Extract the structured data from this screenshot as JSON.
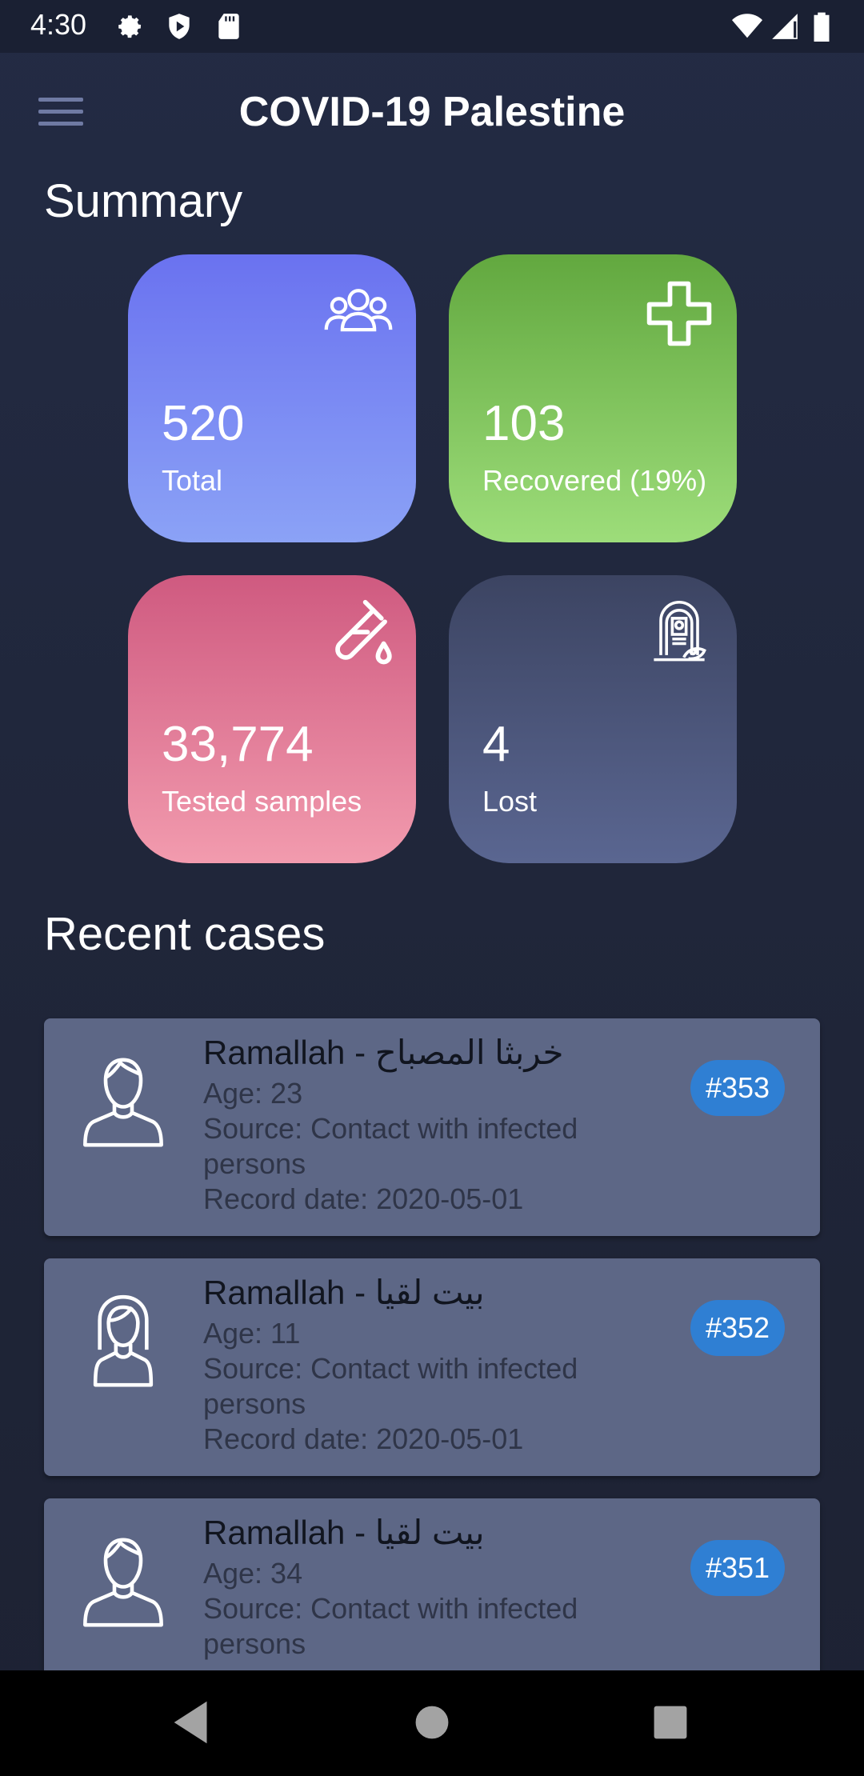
{
  "status_bar": {
    "time": "4:30",
    "icons": [
      "gear-icon",
      "shield-play-icon",
      "sd-card-icon",
      "wifi-icon",
      "signal-icon",
      "battery-icon"
    ]
  },
  "toolbar": {
    "title": "COVID-19 Palestine",
    "menu_icon": "hamburger-menu-icon"
  },
  "summary": {
    "title": "Summary",
    "cards": [
      {
        "value": "520",
        "label": "Total",
        "icon": "people-group-icon"
      },
      {
        "value": "103",
        "label": "Recovered (19%)",
        "icon": "medical-cross-icon"
      },
      {
        "value": "33,774",
        "label": "Tested samples",
        "icon": "test-tube-icon"
      },
      {
        "value": "4",
        "label": "Lost",
        "icon": "gravestone-icon"
      }
    ]
  },
  "recent": {
    "title": "Recent cases",
    "cases": [
      {
        "location": "Ramallah - خربثا المصباح",
        "age": "Age: 23",
        "source_line1": "Source: Contact with infected",
        "source_line2": "persons",
        "date": "Record date: 2020-05-01",
        "id": "#353",
        "avatar": "male-avatar-icon"
      },
      {
        "location": "Ramallah - بيت لقيا",
        "age": "Age: 11",
        "source_line1": "Source: Contact with infected",
        "source_line2": "persons",
        "date": "Record date: 2020-05-01",
        "id": "#352",
        "avatar": "female-avatar-icon"
      },
      {
        "location": "Ramallah - بيت لقيا",
        "age": "Age: 34",
        "source_line1": "Source: Contact with infected",
        "source_line2": "persons",
        "id": "#351",
        "avatar": "male-avatar-icon"
      }
    ]
  },
  "colors": {
    "background": "#222940",
    "total": "#6a72f0",
    "recovered": "#62a83f",
    "tested": "#cf5a80",
    "lost": "#4a5377",
    "case_card": "#5d6786",
    "badge": "#2f7fd3"
  },
  "nav_bar": {
    "icons": [
      "back-icon",
      "home-icon",
      "recents-icon"
    ]
  }
}
